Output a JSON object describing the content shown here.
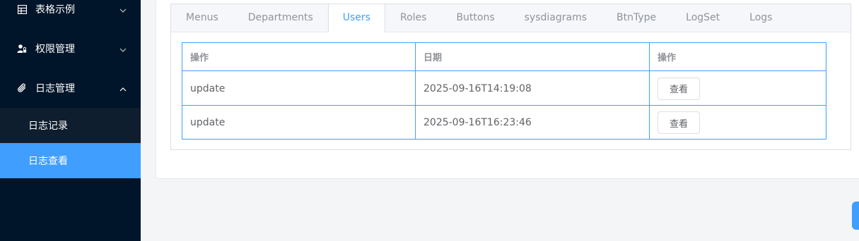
{
  "sidebar": {
    "items": [
      {
        "label": "表格示例",
        "icon": "table-icon",
        "expanded": false
      },
      {
        "label": "权限管理",
        "icon": "user-lock-icon",
        "expanded": false
      },
      {
        "label": "日志管理",
        "icon": "paperclip-icon",
        "expanded": true
      }
    ],
    "subitems": [
      {
        "label": "日志记录",
        "active": false
      },
      {
        "label": "日志查看",
        "active": true
      }
    ]
  },
  "tabs": [
    {
      "label": "Menus",
      "active": false
    },
    {
      "label": "Departments",
      "active": false
    },
    {
      "label": "Users",
      "active": true
    },
    {
      "label": "Roles",
      "active": false
    },
    {
      "label": "Buttons",
      "active": false
    },
    {
      "label": "sysdiagrams",
      "active": false
    },
    {
      "label": "BtnType",
      "active": false
    },
    {
      "label": "LogSet",
      "active": false
    },
    {
      "label": "Logs",
      "active": false
    }
  ],
  "table": {
    "headers": [
      "操作",
      "日期",
      "操作"
    ],
    "rows": [
      {
        "action": "update",
        "date": "2025-09-16T14:19:08",
        "button": "查看"
      },
      {
        "action": "update",
        "date": "2025-09-16T16:23:46",
        "button": "查看"
      }
    ]
  },
  "colors": {
    "sidebar_bg": "#001529",
    "submenu_bg": "#0f1e2e",
    "accent": "#409eff",
    "page_bg": "#f4f5f7"
  }
}
